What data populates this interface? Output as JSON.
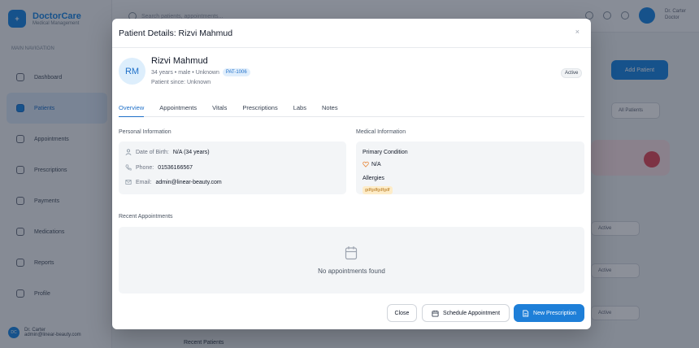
{
  "app": {
    "name": "DoctorCare",
    "subtitle": "Medical Management",
    "nav_section": "MAIN NAVIGATION",
    "nav": [
      {
        "label": "Dashboard"
      },
      {
        "label": "Patients"
      },
      {
        "label": "Appointments"
      },
      {
        "label": "Prescriptions"
      },
      {
        "label": "Payments"
      },
      {
        "label": "Medications"
      },
      {
        "label": "Reports"
      },
      {
        "label": "Profile"
      }
    ],
    "user_name": "Dr. Carter",
    "user_email": "admin@linear-beauty.com",
    "search_placeholder": "Search patients, appointments...",
    "top_user": "Dr. Carter",
    "top_role": "Doctor",
    "add_patient": "Add Patient",
    "filter": "All Patients",
    "row_select": "Active",
    "footer_text": "Recent Patients"
  },
  "modal": {
    "title": "Patient Details: Rizvi Mahmud",
    "close": "×",
    "patient": {
      "initials": "RM",
      "name": "Rizvi Mahmud",
      "meta": "34 years • male • Unknown",
      "id": "PAT-1006",
      "since": "Patient since: Unknown",
      "status": "Active"
    },
    "tabs": [
      "Overview",
      "Appointments",
      "Vitals",
      "Prescriptions",
      "Labs",
      "Notes"
    ],
    "personal": {
      "heading": "Personal Information",
      "dob_label": "Date of Birth:",
      "dob_value": "N/A (34 years)",
      "phone_label": "Phone:",
      "phone_value": "01536166567",
      "email_label": "Email:",
      "email_value": "admin@linear-beauty.com"
    },
    "medical": {
      "heading": "Medical Information",
      "condition_label": "Primary Condition",
      "condition_value": "N/A",
      "allergies_label": "Allergies",
      "allergy_tag": "gdfgdfgdfgdf"
    },
    "recent": {
      "heading": "Recent Appointments",
      "empty": "No appointments found"
    },
    "buttons": {
      "close": "Close",
      "schedule": "Schedule Appointment",
      "new_rx": "New Prescription"
    }
  },
  "colors": {
    "primary": "#1e7fd8",
    "allergy_bg": "#fdecc8",
    "heart": "#e8883a"
  }
}
